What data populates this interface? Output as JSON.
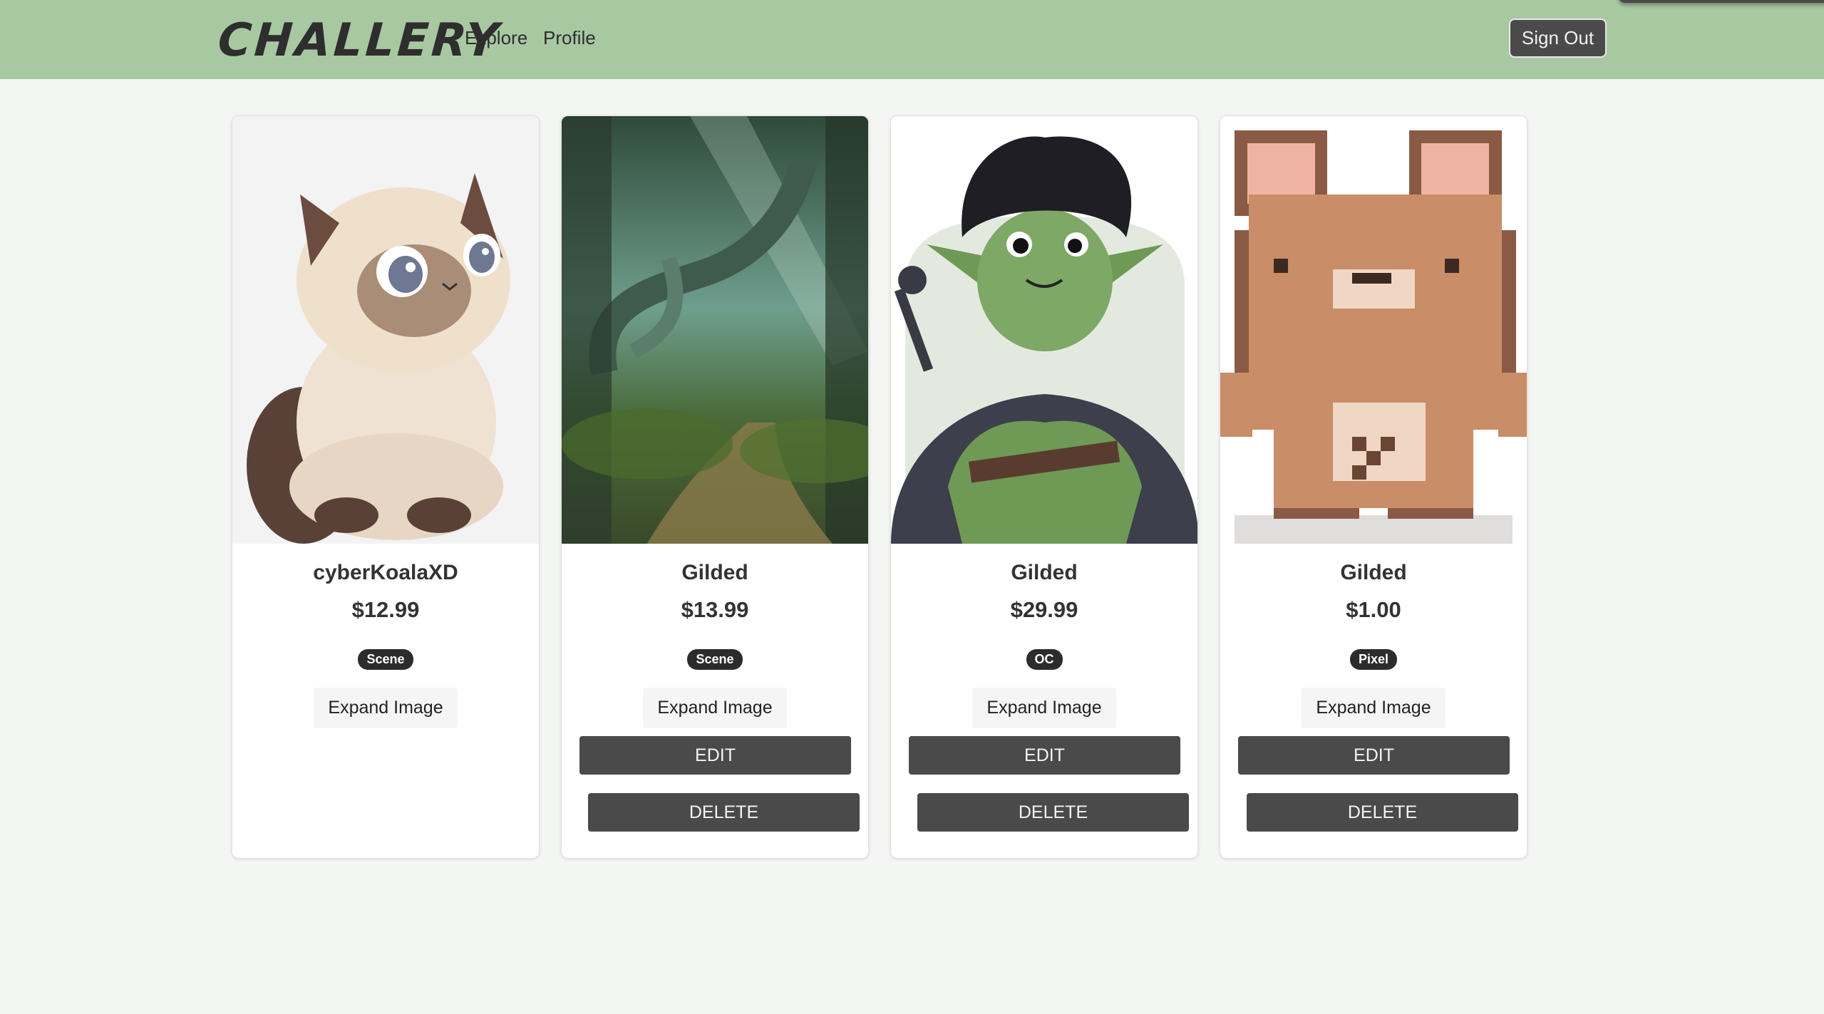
{
  "header": {
    "brand": "CHALLERY",
    "nav": {
      "explore": "Explore",
      "profile": "Profile"
    },
    "sign_out": "Sign Out"
  },
  "colors": {
    "navbar": "#a8c8a2",
    "page_bg": "#f4f6f3",
    "button_dark": "#4a4a4a",
    "badge": "#2c2c2c"
  },
  "cards": [
    {
      "image": "siamese-cat-illustration",
      "title": "cyberKoalaXD",
      "price": "$12.99",
      "tag": "Scene",
      "expand": "Expand Image"
    },
    {
      "image": "forest-path-painting",
      "title": "Gilded",
      "price": "$13.99",
      "tag": "Scene",
      "expand": "Expand Image",
      "edit": "EDIT",
      "delete": "DELETE"
    },
    {
      "image": "goblin-character-illustration",
      "title": "Gilded",
      "price": "$29.99",
      "tag": "OC",
      "expand": "Expand Image",
      "edit": "EDIT",
      "delete": "DELETE"
    },
    {
      "image": "pixel-bear-illustration",
      "title": "Gilded",
      "price": "$1.00",
      "tag": "Pixel",
      "expand": "Expand Image",
      "edit": "EDIT",
      "delete": "DELETE"
    }
  ]
}
